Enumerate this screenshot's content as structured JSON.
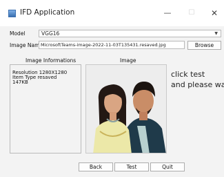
{
  "window": {
    "title": "IFD Application",
    "controls": {
      "minimize": "—",
      "maximize": "☐",
      "close": "✕"
    }
  },
  "model": {
    "label": "Model",
    "selected": "VGG16"
  },
  "image_name": {
    "label": "Image Name",
    "value": "MicrosoftTeams-image-2022-11-03T135431.resaved.jpg",
    "browse_label": "Browse"
  },
  "info_panel": {
    "title": "Image Informations",
    "lines": [
      "Resolution 1280X1280",
      "Item Type resaved",
      "147KB"
    ]
  },
  "image_panel": {
    "title": "Image"
  },
  "status": {
    "line1": "click test",
    "line2": "and please wai"
  },
  "buttons": {
    "back": "Back",
    "test": "Test",
    "quit": "Quit"
  }
}
